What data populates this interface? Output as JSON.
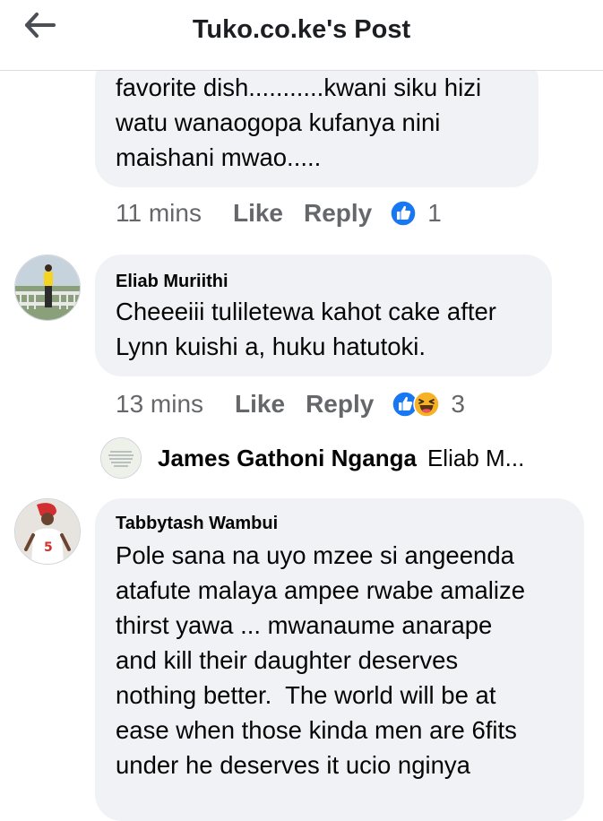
{
  "header": {
    "title": "Tuko.co.ke's Post"
  },
  "comments": [
    {
      "text": "favorite dish...........kwani siku hizi\nwatu wanaogopa kufanya nini\nmaishani mwao.....",
      "time": "11 mins",
      "like_label": "Like",
      "reply_label": "Reply",
      "reaction_count": "1"
    },
    {
      "author": "Eliab Muriithi",
      "text": "Cheeeiii tuliletewa kahot cake after\nLynn kuishi a, huku hatutoki.",
      "time": "13 mins",
      "like_label": "Like",
      "reply_label": "Reply",
      "reaction_count": "3"
    },
    {
      "author": "Tabbytash Wambui",
      "text": "Pole sana na uyo mzee si angeenda\natafute malaya ampee rwabe amalize\nthirst yawa ... mwanaume anarape\nand kill their daughter deserves\nnothing better.  The world will be at\nease when those kinda men are 6fits\nunder he deserves it ucio nginya"
    }
  ],
  "reply_preview": {
    "author": "James Gathoni Nganga",
    "snippet": "Eliab M..."
  },
  "colors": {
    "like_blue": "#1877f2",
    "haha_yellow": "#f7b125"
  }
}
